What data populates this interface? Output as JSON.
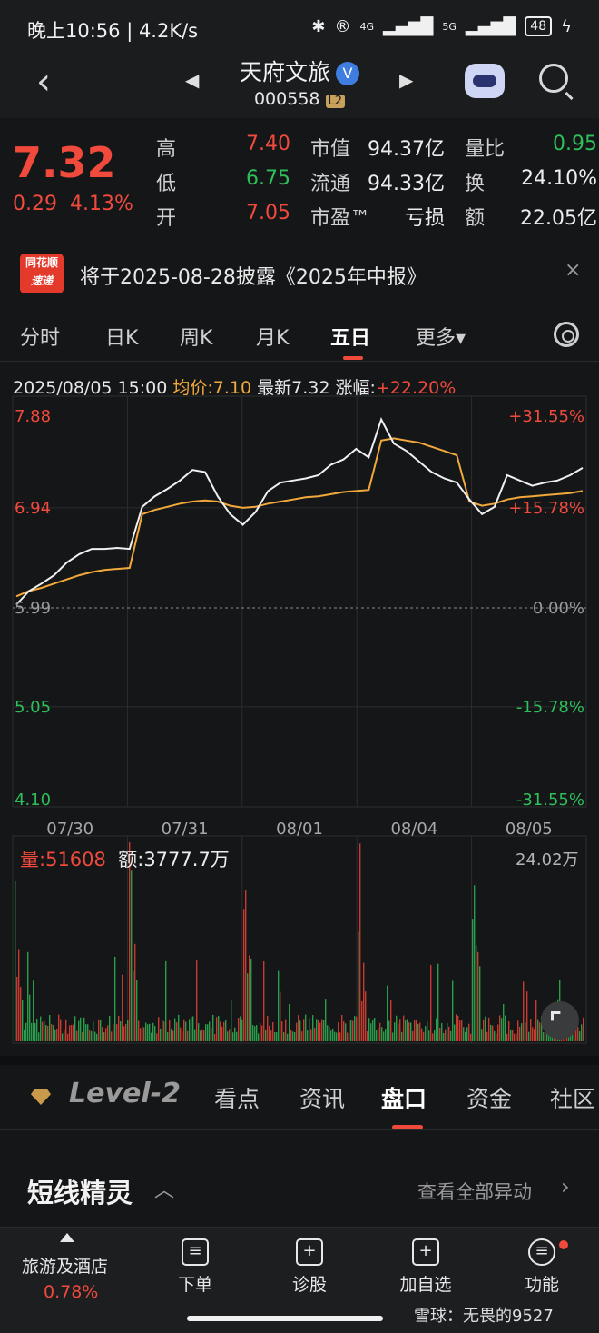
{
  "status": {
    "time": "晚上10:56 | 4.2K/s",
    "battery": "48",
    "net1": "4G",
    "net2": "5G"
  },
  "header": {
    "name": "天府文旅",
    "code": "000558",
    "level": "L2",
    "verified": "V"
  },
  "quote": {
    "price": "7.32",
    "change": "0.29",
    "change_pct": "4.13%",
    "rows": [
      {
        "l1": "高",
        "v1": "7.40",
        "c1": "red",
        "l2": "市值",
        "v2": "94.37亿",
        "l3": "量比",
        "v3": "0.95",
        "c3": "green"
      },
      {
        "l1": "低",
        "v1": "6.75",
        "c1": "green",
        "l2": "流通",
        "v2": "94.33亿",
        "l3": "换",
        "v3": "24.10%",
        "c3": "white"
      },
      {
        "l1": "开",
        "v1": "7.05",
        "c1": "red",
        "l2": "市盈™",
        "v2": "亏损",
        "l3": "额",
        "v3": "22.05亿",
        "c3": "white"
      }
    ]
  },
  "notice": {
    "badge_top": "同花顺",
    "badge_bottom": "速递",
    "text": "将于2025-08-28披露《2025年中报》",
    "close": "×"
  },
  "ktabs": {
    "items": [
      "分时",
      "日K",
      "周K",
      "月K",
      "五日",
      "更多▾"
    ],
    "active": "五日"
  },
  "infoline": {
    "date": "2025/08/05 15:00",
    "avg": "均价:7.10",
    "latest": "最新7.32",
    "rise": "涨幅:",
    "rise_val": "+22.20%"
  },
  "chart_data": {
    "type": "line",
    "x_labels": [
      "07/30",
      "07/31",
      "08/01",
      "08/04",
      "08/05"
    ],
    "y_left": [
      "7.88",
      "6.94",
      "5.99",
      "5.05",
      "4.10"
    ],
    "y_right": [
      "+31.55%",
      "+15.78%",
      "0.00%",
      "-15.78%",
      "-31.55%"
    ],
    "ylim": [
      4.1,
      7.88
    ],
    "reference": 5.99,
    "series": [
      {
        "name": "price",
        "color": "#f0f0f0"
      },
      {
        "name": "均价",
        "color": "#f2a93b"
      }
    ],
    "price": [
      6.02,
      6.15,
      6.22,
      6.3,
      6.42,
      6.5,
      6.55,
      6.55,
      6.56,
      6.55,
      6.95,
      7.05,
      7.12,
      7.2,
      7.3,
      7.28,
      7.05,
      6.88,
      6.78,
      6.9,
      7.1,
      7.18,
      7.2,
      7.22,
      7.25,
      7.35,
      7.4,
      7.5,
      7.42,
      7.78,
      7.55,
      7.48,
      7.38,
      7.28,
      7.22,
      7.18,
      7.02,
      6.88,
      6.95,
      7.25,
      7.2,
      7.15,
      7.18,
      7.2,
      7.25,
      7.32
    ],
    "avg": [
      6.1,
      6.15,
      6.18,
      6.22,
      6.26,
      6.3,
      6.33,
      6.35,
      6.36,
      6.37,
      6.88,
      6.92,
      6.95,
      6.98,
      7.0,
      7.01,
      7.0,
      6.96,
      6.94,
      6.95,
      6.98,
      7.0,
      7.02,
      7.04,
      7.05,
      7.07,
      7.09,
      7.1,
      7.11,
      7.58,
      7.6,
      7.58,
      7.56,
      7.52,
      7.48,
      7.44,
      7.0,
      6.96,
      6.98,
      7.02,
      7.04,
      7.05,
      7.06,
      7.07,
      7.08,
      7.1
    ]
  },
  "volume": {
    "label": "量:",
    "value": "51608",
    "amount": "额:3777.7万",
    "max": "24.02万"
  },
  "btabs": {
    "level": "Level-2",
    "items": [
      "看点",
      "资讯",
      "盘口",
      "资金",
      "社区"
    ],
    "active": "盘口"
  },
  "spirit": {
    "title": "短线精灵",
    "link": "查看全部异动"
  },
  "bnav": {
    "industry": "旅游及酒店",
    "industry_pct": "0.78%",
    "items": [
      "下单",
      "诊股",
      "加自选",
      "功能"
    ]
  },
  "watermark": "雪球：无畏的9527"
}
